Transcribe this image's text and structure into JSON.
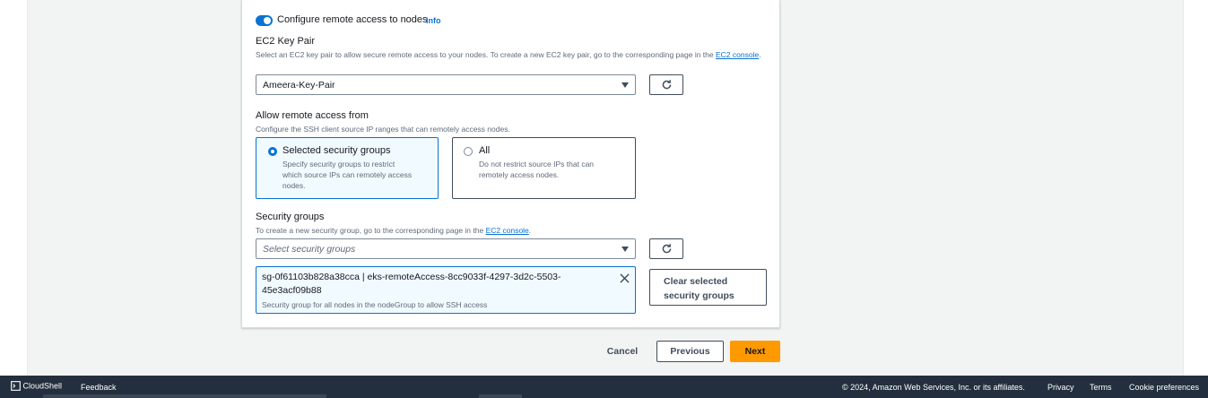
{
  "remote_access": {
    "toggle_label": "Configure remote access to nodes",
    "toggle_on": true,
    "info_label": "Info"
  },
  "key_pair": {
    "label": "EC2 Key Pair",
    "description": "Select an EC2 key pair to allow secure remote access to your nodes. To create a new EC2 key pair, go to the corresponding page in the",
    "link_part1": "EC2",
    "link_part2": "console",
    "link_suffix": ".",
    "selected_value": "Ameera-Key-Pair"
  },
  "allow_from": {
    "label": "Allow remote access from",
    "description": "Configure the SSH client source IP ranges that can remotely access nodes.",
    "options": [
      {
        "title": "Selected security groups",
        "desc_lines": [
          "Specify security groups to restrict",
          "which source IPs can remotely access",
          "nodes."
        ],
        "selected": true
      },
      {
        "title": "All",
        "desc_lines": [
          "Do not restrict source IPs that can",
          "remotely access nodes."
        ],
        "selected": false
      }
    ]
  },
  "security_groups": {
    "label": "Security groups",
    "description": "To create a new security group, go to the corresponding page in the",
    "link": "EC2 console",
    "link_suffix": ".",
    "placeholder": "Select security groups",
    "token_line1": "sg-0f61103b828a38cca | eks-remoteAccess-8cc9033f-4297-3d2c-5503-",
    "token_line2": "45e3acf09b88",
    "token_description": "Security group for all nodes in the nodeGroup to allow SSH access",
    "clear_line1": "Clear selected",
    "clear_line2": "security groups"
  },
  "actions": {
    "cancel": "Cancel",
    "previous": "Previous",
    "next": "Next",
    "primary_color": "#ff9900"
  },
  "footer": {
    "cloudshell": "CloudShell",
    "feedback": "Feedback",
    "copyright": "© 2024, Amazon Web Services, Inc. or its affiliates.",
    "privacy": "Privacy",
    "terms": "Terms",
    "cookies": "Cookie preferences"
  }
}
